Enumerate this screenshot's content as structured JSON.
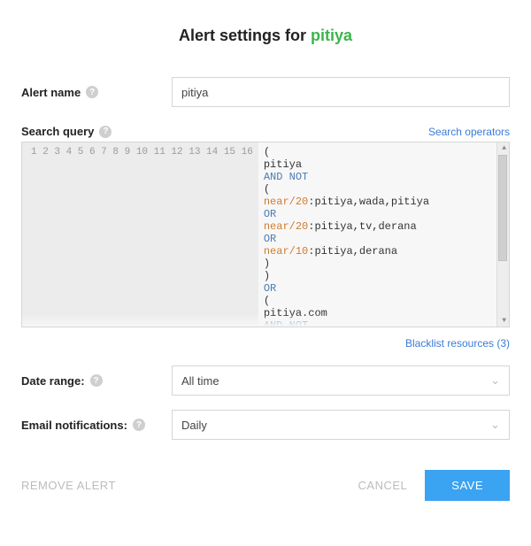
{
  "title_prefix": "Alert settings for ",
  "title_name": "pitiya",
  "alert_name": {
    "label": "Alert name",
    "value": "pitiya"
  },
  "search_query": {
    "label": "Search query",
    "operators_link": "Search operators",
    "lines": [
      {
        "n": 1,
        "tokens": [
          {
            "t": "(",
            "c": ""
          }
        ]
      },
      {
        "n": 2,
        "tokens": [
          {
            "t": "pitiya",
            "c": ""
          }
        ]
      },
      {
        "n": 3,
        "tokens": [
          {
            "t": "AND NOT",
            "c": "kw"
          }
        ]
      },
      {
        "n": 4,
        "tokens": [
          {
            "t": "(",
            "c": ""
          }
        ]
      },
      {
        "n": 5,
        "tokens": [
          {
            "t": "near/20",
            "c": "fn"
          },
          {
            "t": ":pitiya,wada,pitiya",
            "c": ""
          }
        ]
      },
      {
        "n": 6,
        "tokens": [
          {
            "t": "OR",
            "c": "kw"
          }
        ]
      },
      {
        "n": 7,
        "tokens": [
          {
            "t": "near/20",
            "c": "fn"
          },
          {
            "t": ":pitiya,tv,derana",
            "c": ""
          }
        ]
      },
      {
        "n": 8,
        "tokens": [
          {
            "t": "OR",
            "c": "kw"
          }
        ]
      },
      {
        "n": 9,
        "tokens": [
          {
            "t": "near/10",
            "c": "fn"
          },
          {
            "t": ":pitiya,derana",
            "c": ""
          }
        ]
      },
      {
        "n": 10,
        "tokens": [
          {
            "t": ")",
            "c": ""
          }
        ]
      },
      {
        "n": 11,
        "tokens": [
          {
            "t": ")",
            "c": ""
          }
        ]
      },
      {
        "n": 12,
        "tokens": [
          {
            "t": "OR",
            "c": "kw"
          }
        ]
      },
      {
        "n": 13,
        "tokens": [
          {
            "t": "(",
            "c": ""
          }
        ]
      },
      {
        "n": 14,
        "tokens": [
          {
            "t": "pitiya.com",
            "c": ""
          }
        ]
      },
      {
        "n": 15,
        "tokens": [
          {
            "t": "AND NOT",
            "c": "kw"
          }
        ]
      },
      {
        "n": 16,
        "tokens": [
          {
            "t": "(",
            "c": ""
          }
        ]
      }
    ]
  },
  "blacklist": {
    "label": "Blacklist resources (3)"
  },
  "date_range": {
    "label": "Date range:",
    "value": "All time"
  },
  "email_notifications": {
    "label": "Email notifications:",
    "value": "Daily"
  },
  "footer": {
    "remove": "REMOVE ALERT",
    "cancel": "CANCEL",
    "save": "SAVE"
  }
}
